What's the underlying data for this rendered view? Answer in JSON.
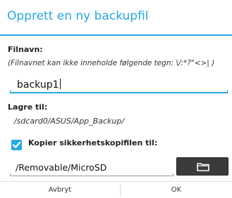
{
  "dialog": {
    "title": "Opprett en ny backupfil",
    "accent_color": "#2aa7dd"
  },
  "filename": {
    "label": "Filnavn:",
    "hint": "(Filnavnet kan ikke inneholde følgende tegn: \\/:*?\"<>| )",
    "value": "backup1"
  },
  "save_to": {
    "label": "Lagre til:",
    "path": "/sdcard0/ASUS/App_Backup/"
  },
  "copy_option": {
    "checked": true,
    "label": "Kopier sikkerhetskopifilen til:",
    "destination": "/Removable/MicroSD",
    "browse_icon": "folder-icon"
  },
  "buttons": {
    "cancel": "Avbryt",
    "ok": "OK"
  }
}
